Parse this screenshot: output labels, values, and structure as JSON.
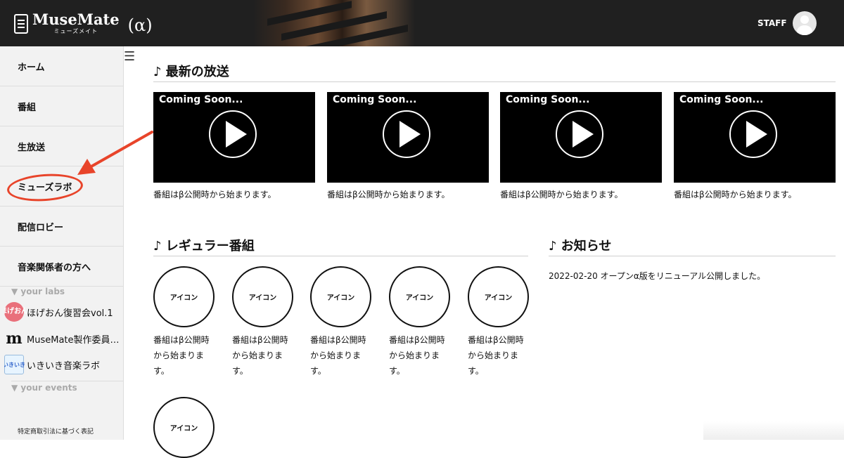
{
  "header": {
    "logo_text": "MuseMate",
    "logo_sub": "ミューズメイト",
    "alpha": "(α)",
    "staff": "STAFF"
  },
  "sidebar": {
    "items": [
      {
        "label": "ホーム"
      },
      {
        "label": "番組"
      },
      {
        "label": "生放送"
      },
      {
        "label": "ミューズラボ"
      },
      {
        "label": "配信ロビー"
      },
      {
        "label": "音楽関係者の方へ"
      }
    ],
    "labs_heading": "▼ your labs",
    "labs": [
      {
        "label": "ほげおん復習会vol.1",
        "thumb": "ほげおん"
      },
      {
        "label": "MuseMate製作委員…",
        "thumb": "m"
      },
      {
        "label": "いきいき音楽ラボ",
        "thumb": "いきいき"
      }
    ],
    "events_heading": "▼ your events",
    "footer": "特定商取引法に基づく表記"
  },
  "latest": {
    "title": "♪ 最新の放送",
    "videos": [
      {
        "title": "Coming Soon...",
        "caption": "番組はβ公開時から始まります。"
      },
      {
        "title": "Coming Soon...",
        "caption": "番組はβ公開時から始まります。"
      },
      {
        "title": "Coming Soon...",
        "caption": "番組はβ公開時から始まります。"
      },
      {
        "title": "Coming Soon...",
        "caption": "番組はβ公開時から始まります。"
      }
    ]
  },
  "regular": {
    "title": "♪ レギュラー番組",
    "programs": [
      {
        "icon": "アイコン",
        "caption": "番組はβ公開時から始まります。"
      },
      {
        "icon": "アイコン",
        "caption": "番組はβ公開時から始まります。"
      },
      {
        "icon": "アイコン",
        "caption": "番組はβ公開時から始まります。"
      },
      {
        "icon": "アイコン",
        "caption": "番組はβ公開時から始まります。"
      },
      {
        "icon": "アイコン",
        "caption": "番組はβ公開時から始まります。"
      },
      {
        "icon": "アイコン",
        "caption": ""
      }
    ]
  },
  "news": {
    "title": "♪ お知らせ",
    "items": [
      {
        "text": "2022-02-20 オープンα版をリニューアル公開しました。"
      }
    ]
  },
  "colors": {
    "header_bg": "#202020",
    "sidebar_bg": "#f2f2f2",
    "annotation": "#e8442a"
  }
}
